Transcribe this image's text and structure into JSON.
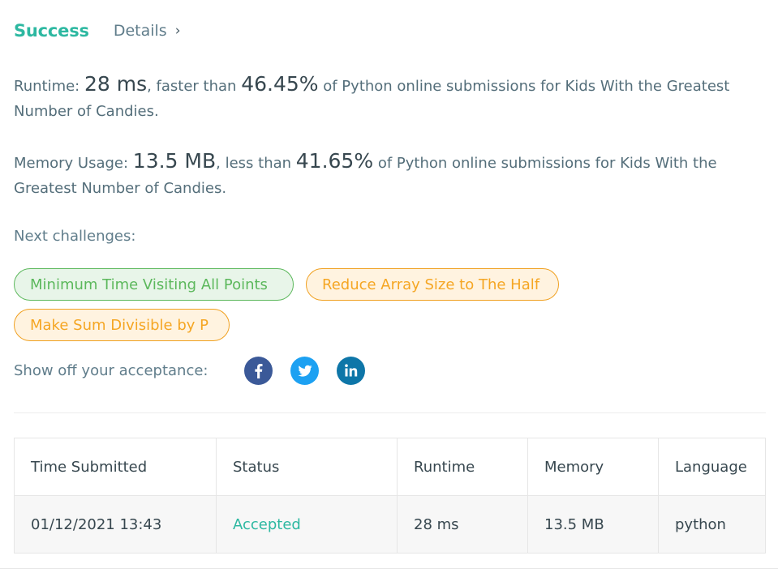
{
  "header": {
    "status": "Success",
    "details_label": "Details",
    "details_chevron": "›"
  },
  "runtime": {
    "label": "Runtime: ",
    "value": "28 ms",
    "comparison": ", faster than ",
    "percent": "46.45%",
    "suffix": " of Python online submissions for Kids With the Greatest Number of Candies."
  },
  "memory": {
    "label": "Memory Usage: ",
    "value": "13.5 MB",
    "comparison": ", less than ",
    "percent": "41.65%",
    "suffix": " of Python online submissions for Kids With the Greatest Number of Candies."
  },
  "next": {
    "label": "Next challenges:",
    "challenges": [
      {
        "label": "Minimum Time Visiting All Points",
        "difficulty_color": "#5cb85c"
      },
      {
        "label": "Reduce Array Size to The Half",
        "difficulty_color": "#f0ad4e"
      },
      {
        "label": "Make Sum Divisible by P",
        "difficulty_color": "#f0ad4e"
      }
    ]
  },
  "share": {
    "label": "Show off your acceptance:",
    "icons": [
      "facebook-icon",
      "twitter-icon",
      "linkedin-icon"
    ]
  },
  "submissions": {
    "columns": [
      "Time Submitted",
      "Status",
      "Runtime",
      "Memory",
      "Language"
    ],
    "rows": [
      [
        "01/12/2021 13:43",
        "Accepted",
        "28 ms",
        "13.5 MB",
        "python"
      ]
    ]
  },
  "colors": {
    "accent": "#2db8a1",
    "easy": "#5cb85c",
    "medium": "#f0ad4e"
  }
}
